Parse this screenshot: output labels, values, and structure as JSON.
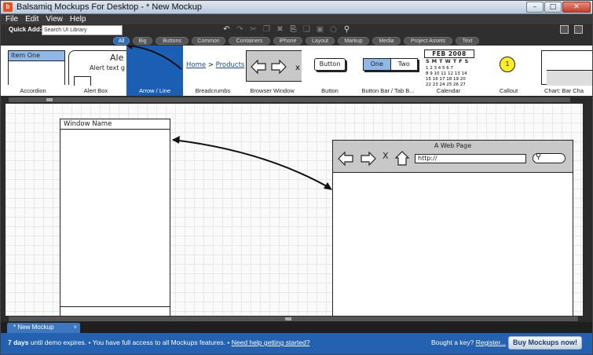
{
  "window": {
    "title": "Balsamiq Mockups For Desktop - * New Mockup",
    "logo_text": "b",
    "controls": [
      "–",
      "□",
      "✕"
    ]
  },
  "menu": [
    "File",
    "Edit",
    "View",
    "Help"
  ],
  "quick_add": {
    "label": "Quick Add:",
    "placeholder": "Search UI Library"
  },
  "toolbar_icons": [
    "undo-icon",
    "redo-icon",
    "cut-icon",
    "copy-icon",
    "delete-icon",
    "paste-icon",
    "duplicate-icon",
    "group-icon",
    "lock-icon",
    "search-icon"
  ],
  "filter_tabs": [
    "All",
    "Big",
    "Buttons",
    "Common",
    "Containers",
    "iPhone",
    "Layout",
    "Markup",
    "Media",
    "Project Assets",
    "Text"
  ],
  "components": [
    {
      "label": "Accordion",
      "preview": "Item One"
    },
    {
      "label": "Alert Box",
      "preview_title": "Ale",
      "preview_text": "Alert text g"
    },
    {
      "label": "Arrow / Line"
    },
    {
      "label": "Breadcrumbs",
      "preview_home": "Home",
      "preview_sep": ">",
      "preview_item": "Products"
    },
    {
      "label": "Browser Window"
    },
    {
      "label": "Button",
      "preview": "Button"
    },
    {
      "label": "Button Bar / Tab B...",
      "preview_one": "One",
      "preview_two": "Two"
    },
    {
      "label": "Calendar",
      "preview": "FEB 2008",
      "days": "SMTWTFS"
    },
    {
      "label": "Callout",
      "preview": "1"
    },
    {
      "label": "Chart: Bar Cha"
    }
  ],
  "canvas": {
    "window_title": "Window Name",
    "browser_title": "A Web Page",
    "browser_url": "http://",
    "nav_close": "X"
  },
  "doc_tab": {
    "label": "* New Mockup",
    "close": "×"
  },
  "status": {
    "days_bold": "7 days",
    "text1": " until demo expires.  •  You have full access to all Mockups features.  •  ",
    "link_help": "Need help getting started?",
    "key_text": "Bought a key? ",
    "link_register": "Register...",
    "buy_button": "Buy Mockups now!"
  },
  "colors": {
    "selected_tab": "#2d6bb5",
    "status_bar": "#2461b0",
    "selected_component": "#1a5fb4",
    "chrome_dark": "#2f2f2f",
    "callout_yellow": "#ffee22"
  }
}
